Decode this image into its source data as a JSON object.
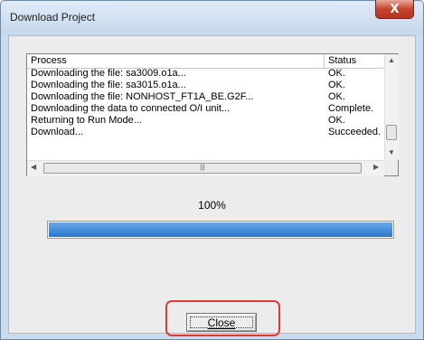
{
  "window": {
    "title": "Download Project",
    "close_glyph": "X"
  },
  "list": {
    "columns": {
      "process": "Process",
      "status": "Status"
    },
    "rows": [
      {
        "process": "Downloading the file: sa3009.o1a...",
        "status": "OK."
      },
      {
        "process": "Downloading the file: sa3015.o1a...",
        "status": "OK."
      },
      {
        "process": "Downloading the file: NONHOST_FT1A_BE.G2F...",
        "status": "OK."
      },
      {
        "process": "Downloading the data to connected O/I unit...",
        "status": "Complete."
      },
      {
        "process": "Returning to Run Mode...",
        "status": "OK."
      },
      {
        "process": "Download...",
        "status": "Succeeded."
      }
    ]
  },
  "progress": {
    "text": "100%",
    "fraction": 1.0
  },
  "buttons": {
    "close_label": "Close"
  },
  "colors": {
    "progress_fill": "#2a77d1",
    "highlight": "#e03a33"
  }
}
